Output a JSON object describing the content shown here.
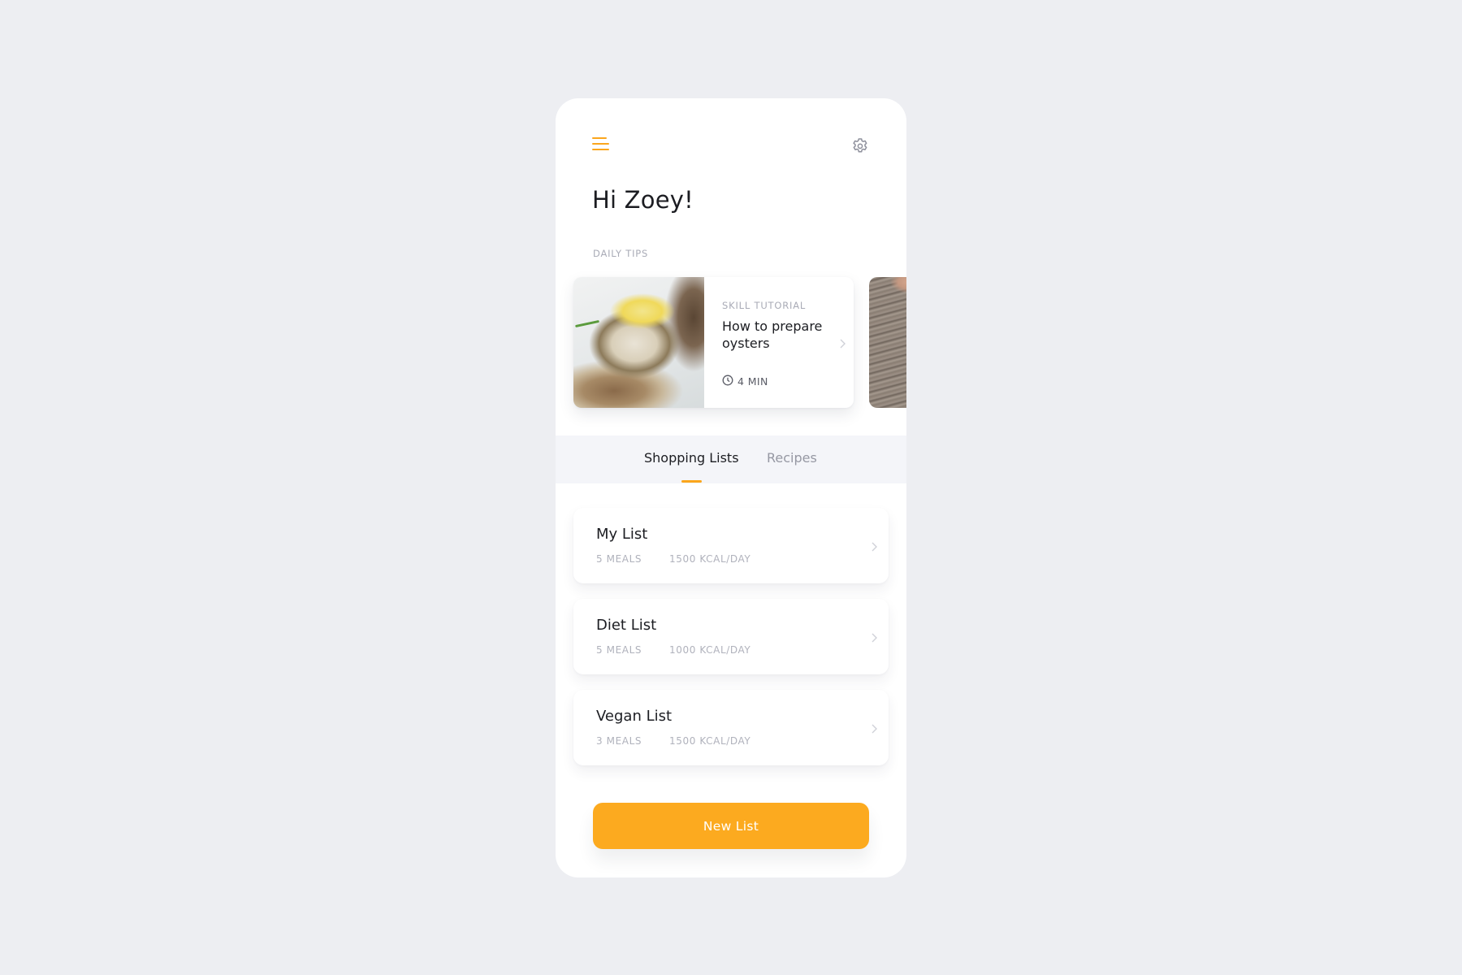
{
  "header": {
    "menu_icon": "hamburger-menu-icon",
    "settings_icon": "gear-icon",
    "greeting": "Hi Zoey!"
  },
  "daily_tips": {
    "label": "DAILY TIPS",
    "cards": [
      {
        "image": "oysters-on-ice-photo",
        "kicker": "SKILL TUTORIAL",
        "title": "How to prepare oysters",
        "duration": "4 MIN",
        "duration_icon": "clock-icon",
        "chevron_icon": "chevron-right-icon"
      },
      {
        "image": "wooden-board-photo"
      }
    ]
  },
  "tabs": [
    {
      "label": "Shopping Lists",
      "active": true
    },
    {
      "label": "Recipes",
      "active": false
    }
  ],
  "lists": [
    {
      "name": "My List",
      "meals": "5 MEALS",
      "kcal": "1500 KCAL/DAY"
    },
    {
      "name": "Diet List",
      "meals": "5 MEALS",
      "kcal": "1000 KCAL/DAY"
    },
    {
      "name": "Vegan List",
      "meals": "3 MEALS",
      "kcal": "1500 KCAL/DAY"
    }
  ],
  "actions": {
    "new_list_label": "New List"
  },
  "colors": {
    "accent": "#fba61c",
    "background": "#edeef2",
    "text_primary": "#1c1d22",
    "text_muted": "#a9abb6"
  }
}
